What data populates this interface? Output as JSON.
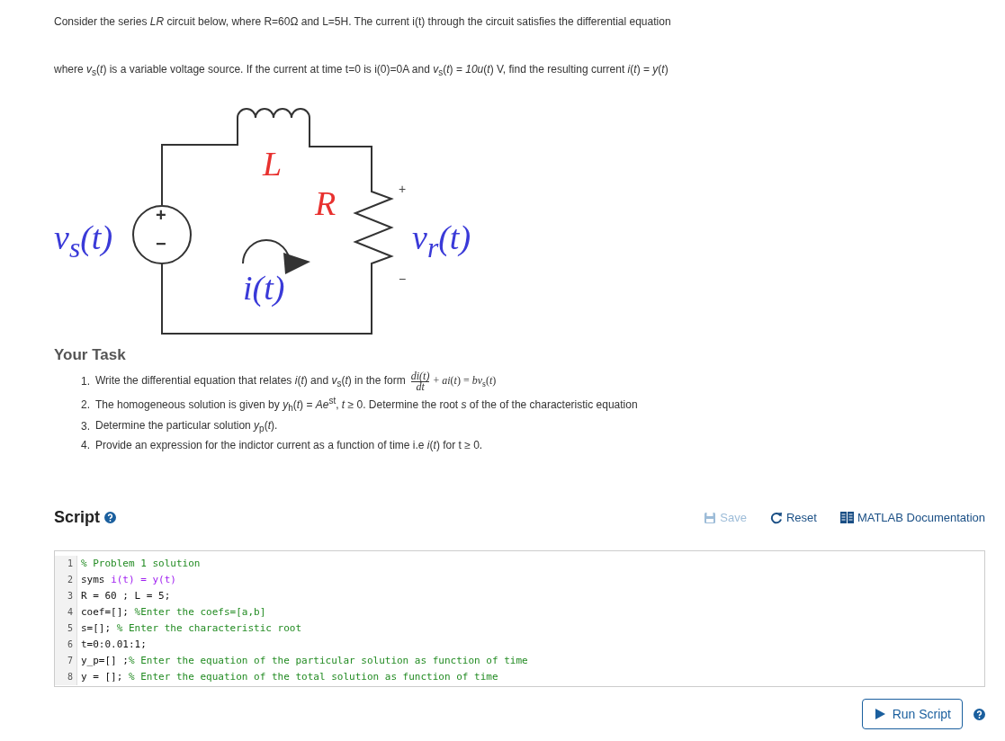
{
  "intro": [
    "Consider the series *LR* circuit below, where R=60Ω and L=5H. The current i(t) through the circuit satisfies the differential equation",
    "where *v*$_{s}$(*t*) is a variable voltage source. If the current at time t=0 is i(0)=0A and *v*$_{s}$(*t*) = *10u*(*t*) V, find the resulting current *i*(*t*) = *y*(*t*)"
  ],
  "circuit": {
    "labels": [
      {
        "kind": "inductor",
        "text": "L"
      },
      {
        "kind": "resistor",
        "text": "R"
      },
      {
        "kind": "plus",
        "text": "+"
      },
      {
        "kind": "minus",
        "text": "−"
      },
      {
        "kind": "source",
        "text": "v$_{s}$(t)"
      },
      {
        "kind": "resistor-voltage",
        "text": "v$_{r}$(t)"
      },
      {
        "kind": "current",
        "text": "i(t)"
      },
      {
        "kind": "source-plus",
        "text": "+"
      },
      {
        "kind": "source-minus",
        "text": "−"
      }
    ]
  },
  "task": {
    "title": "Your Task",
    "items": [
      {
        "number": "1.",
        "text": "Write the differential equation that relates *i*(*t*) and *v*$_{s}$(*t*) in the form",
        "fraction": {
          "numerator": "di(t)",
          "denominator": "dt"
        },
        "after": "+ *ai*(*t*) = *bv*$_{s}$(*t*)"
      },
      {
        "number": "2.",
        "text": "The homogeneous solution is given by  *y*$_{h}$(*t*) = *Ae*$^{st}$,   *t* ≥ 0.  Determine  the root *s* of the of the characteristic equation"
      },
      {
        "number": "3.",
        "text": "Determine the particular solution *y*$_{p}$(*t*)."
      },
      {
        "number": "4.",
        "text": "Provide an expression for the indictor current as a function of time  i.e *i*(*t*) for t ≥  0."
      }
    ]
  },
  "script": {
    "title": "Script",
    "actions": [
      {
        "kind": "save",
        "label": "Save",
        "disabled": true
      },
      {
        "kind": "reset",
        "label": "Reset",
        "disabled": false
      },
      {
        "kind": "docs",
        "label": "MATLAB Documentation",
        "disabled": false
      }
    ],
    "lines": [
      {
        "number": "1",
        "segments": [
          {
            "kind": "comment",
            "text": "% Problem 1 solution"
          }
        ]
      },
      {
        "number": "2",
        "segments": [
          {
            "kind": "plain",
            "text": "syms "
          },
          {
            "kind": "symbolic",
            "text": "i(t) = y(t)"
          }
        ]
      },
      {
        "number": "3",
        "segments": [
          {
            "kind": "plain",
            "text": "R = 60 ; L = 5;"
          }
        ]
      },
      {
        "number": "4",
        "segments": [
          {
            "kind": "plain",
            "text": "coef=[]; "
          },
          {
            "kind": "comment",
            "text": "%Enter the coefs=[a,b]"
          }
        ]
      },
      {
        "number": "5",
        "segments": [
          {
            "kind": "plain",
            "text": "s=[]; "
          },
          {
            "kind": "comment",
            "text": "% Enter the characteristic root"
          }
        ]
      },
      {
        "number": "6",
        "segments": [
          {
            "kind": "plain",
            "text": "t=0:0.01:1;"
          }
        ]
      },
      {
        "number": "7",
        "segments": [
          {
            "kind": "plain",
            "text": "y_p=[] ;"
          },
          {
            "kind": "comment",
            "text": "% Enter the equation of the particular solution as function of time"
          }
        ]
      },
      {
        "number": "8",
        "segments": [
          {
            "kind": "plain",
            "text": "y = []; "
          },
          {
            "kind": "comment",
            "text": "% Enter the equation of the total solution as function of time"
          }
        ]
      }
    ],
    "run_button": "Run Script"
  }
}
